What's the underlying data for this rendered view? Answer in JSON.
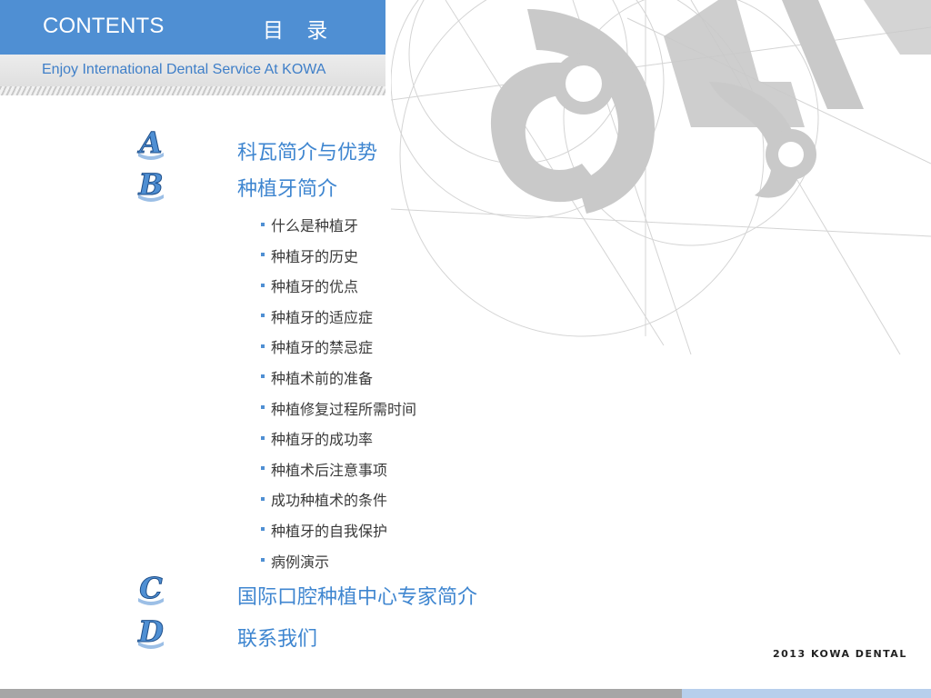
{
  "header": {
    "title": "CONTENTS",
    "title_cn": "目 录",
    "subtitle": "Enjoy International Dental Service At KOWA"
  },
  "sections": [
    {
      "letter": "A",
      "title": "科瓦简介与优势"
    },
    {
      "letter": "B",
      "title": "种植牙简介"
    },
    {
      "letter": "C",
      "title": "国际口腔种植中心专家简介"
    },
    {
      "letter": "D",
      "title": "联系我们"
    }
  ],
  "subitems": [
    "什么是种植牙",
    "种植牙的历史",
    "种植牙的优点",
    "种植牙的适应症",
    "种植牙的禁忌症",
    "种植术前的准备",
    "种植修复过程所需时间",
    "种植牙的成功率",
    "种植术后注意事项",
    "成功种植术的条件",
    "种植牙的自我保护",
    "病例演示"
  ],
  "brand": "2013 KOWA DENTAL",
  "colors": {
    "accent": "#4f8fd3",
    "title_text": "#3f86d0",
    "decor_gray": "#c8c8c8"
  }
}
